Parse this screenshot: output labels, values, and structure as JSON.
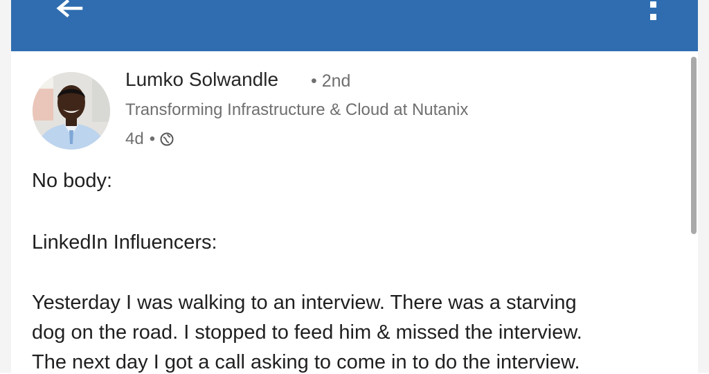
{
  "post": {
    "author_name": "Lumko Solwandle",
    "connection_degree": "• 2nd",
    "headline": "Transforming Infrastructure & Cloud at Nutanix",
    "age": "4d",
    "separator": "•",
    "visibility_icon": "globe-icon",
    "body_lines": [
      "No body:",
      "LinkedIn Influencers:",
      "Yesterday I was walking to an interview. There was a starving",
      "dog on the road. I stopped to feed him & missed the interview.",
      "The next day I got a call asking to come in to do the interview."
    ]
  },
  "app_bar": {
    "back_icon": "back-arrow-icon",
    "menu_icon": "more-vertical-icon"
  },
  "colors": {
    "app_bar": "#2f6db0",
    "text_primary": "#1f1f1f",
    "text_secondary": "#6f6f6f"
  }
}
